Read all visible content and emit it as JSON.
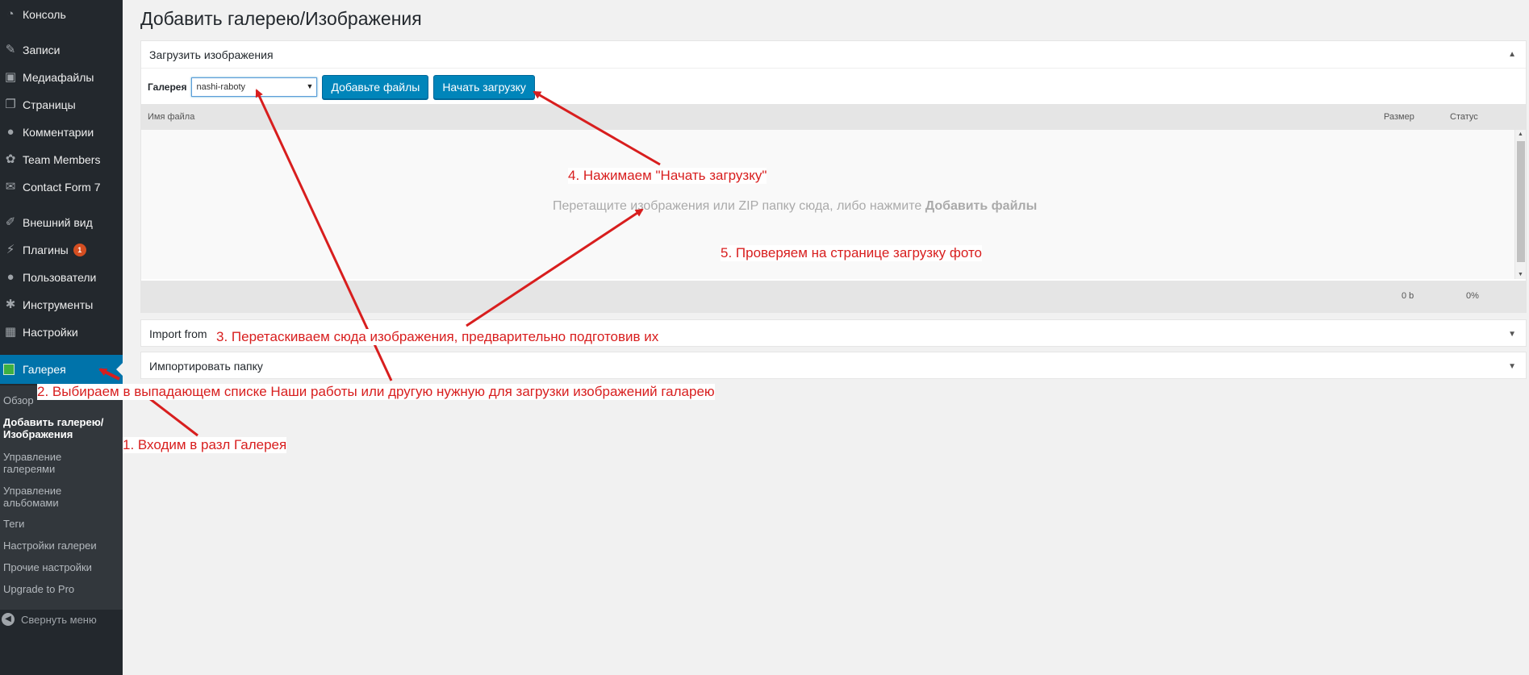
{
  "sidebar": {
    "items": [
      {
        "label": "Консоль",
        "icon": "dashboard-icon"
      },
      {
        "label": "Записи",
        "icon": "pin-icon"
      },
      {
        "label": "Медиафайлы",
        "icon": "media-icon"
      },
      {
        "label": "Страницы",
        "icon": "pages-icon"
      },
      {
        "label": "Комментарии",
        "icon": "comment-icon"
      },
      {
        "label": "Team Members",
        "icon": "groups-icon"
      },
      {
        "label": "Contact Form 7",
        "icon": "envelope-icon"
      },
      {
        "label": "Внешний вид",
        "icon": "brush-icon"
      },
      {
        "label": "Плагины",
        "icon": "plugin-icon",
        "badge": "1"
      },
      {
        "label": "Пользователи",
        "icon": "user-icon"
      },
      {
        "label": "Инструменты",
        "icon": "wrench-icon"
      },
      {
        "label": "Настройки",
        "icon": "settings-icon"
      }
    ],
    "current": {
      "label": "Галерея",
      "icon": "gallery-icon",
      "color": "#3cb043"
    },
    "submenu": [
      {
        "label": "Обзор"
      },
      {
        "label": "Добавить галерею/ Изображения"
      },
      {
        "label": "Управление галереями"
      },
      {
        "label": "Управление альбомами"
      },
      {
        "label": "Теги"
      },
      {
        "label": "Настройки галереи"
      },
      {
        "label": "Прочие настройки"
      },
      {
        "label": "Upgrade to Pro"
      }
    ],
    "collapse_label": "Свернуть меню"
  },
  "page": {
    "title": "Добавить галерею/Изображения"
  },
  "upload_panel": {
    "title": "Загрузить изображения",
    "gallery_label": "Галерея",
    "gallery_value": "nashi-raboty",
    "add_files_label": "Добавьте файлы",
    "start_upload_label": "Начать загрузку",
    "columns": {
      "filename": "Имя файла",
      "size": "Размер",
      "status": "Статус"
    },
    "drop_text": "Перетащите изображения или ZIP папку сюда, либо нажмите",
    "drop_text_bold": "Добавить файлы",
    "total_size": "0 b",
    "total_percent": "0%"
  },
  "import_panel": {
    "title": "Import from"
  },
  "folder_panel": {
    "title": "Импортировать папку"
  },
  "annotations": {
    "step1": "1. Входим в разл Галерея",
    "step2": "2. Выбираем в выпадающем списке Наши работы или другую нужную для загрузки изображений галарею",
    "step3": "3. Перетаскиваем сюда изображения, предварительно подготовив их",
    "step4": "4. Нажимаем \"Начать загрузку\"",
    "step5": "5. Проверяем на странице загрузку фото"
  },
  "colors": {
    "accent": "#0073aa",
    "button": "#0085ba",
    "annotation": "#d81e1e",
    "sidebar": "#23282d"
  }
}
